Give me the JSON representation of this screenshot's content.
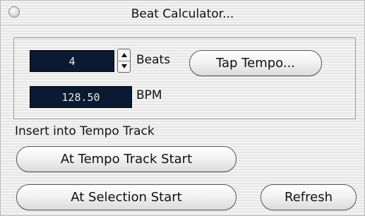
{
  "window": {
    "title": "Beat Calculator..."
  },
  "beats": {
    "value": "4",
    "label": "Beats"
  },
  "bpm": {
    "value": "128.50",
    "label": "BPM"
  },
  "buttons": {
    "tap_tempo": "Tap Tempo...",
    "at_tempo_track_start": "At Tempo Track Start",
    "at_selection_start": "At Selection Start",
    "refresh": "Refresh"
  },
  "insert": {
    "label": "Insert into Tempo Track"
  }
}
